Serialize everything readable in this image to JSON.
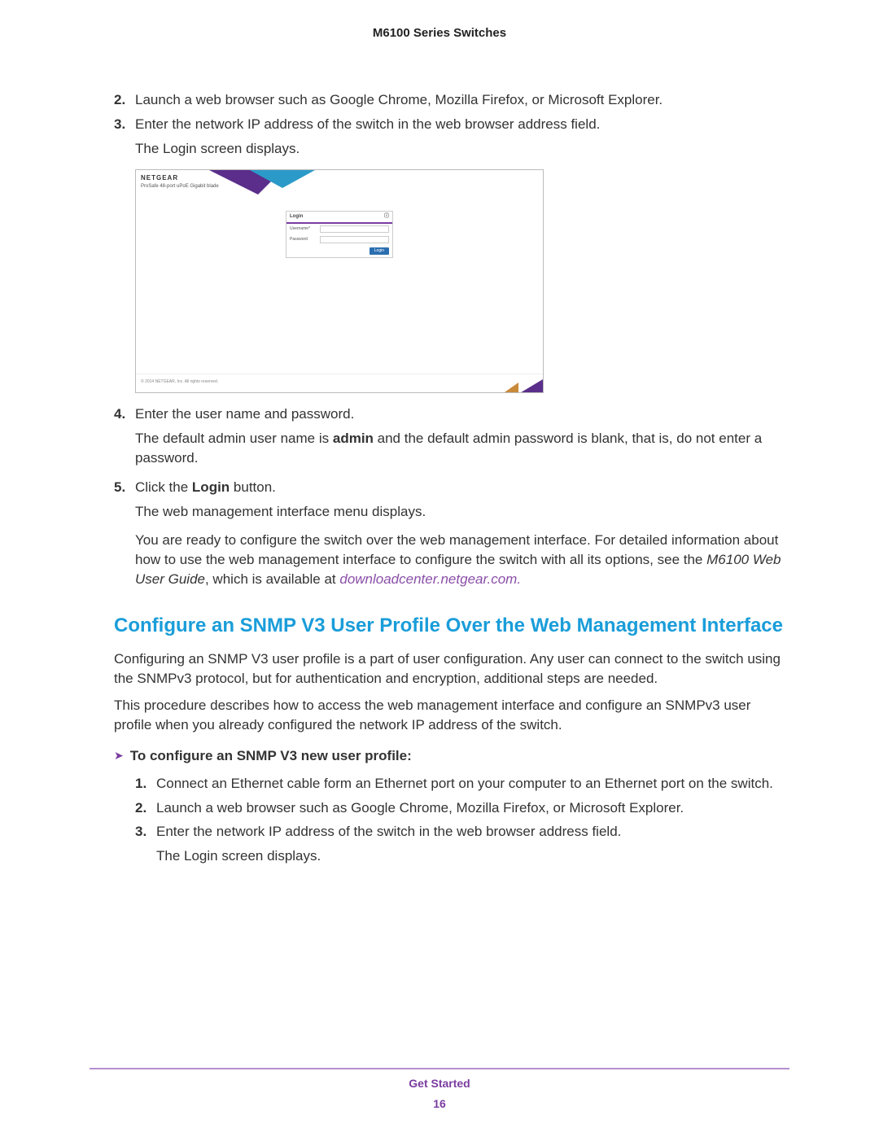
{
  "header": {
    "title": "M6100 Series Switches"
  },
  "steps_top": [
    {
      "num": "2.",
      "text": "Launch a web browser such as Google Chrome, Mozilla Firefox, or Microsoft Explorer."
    },
    {
      "num": "3.",
      "text": "Enter the network IP address of the switch in the web browser address field."
    }
  ],
  "login_displays": "The Login screen displays.",
  "login_figure": {
    "brand": "NETGEAR",
    "subtitle": "ProSafe 48-port uPoE Gigabit blade",
    "card_title": "Login",
    "username_label": "Username*",
    "password_label": "Password",
    "login_button": "Login",
    "copyright": "© 2014 NETGEAR, Inc. All rights reserved."
  },
  "step4": {
    "num": "4.",
    "text": "Enter the user name and password.",
    "detail_pre": "The default admin user name is ",
    "detail_bold": "admin",
    "detail_post": " and the default admin password is blank, that is, do not enter a password."
  },
  "step5": {
    "num": "5.",
    "pre": "Click the ",
    "bold": "Login",
    "post": " button.",
    "result": "The web management interface menu displays.",
    "ready_pre": "You are ready to configure the switch over the web management interface. For detailed information about how to use the web management interface to configure the switch with all its options, see the ",
    "ready_italic": "M6100 Web User Guide",
    "ready_mid": ", which is available at ",
    "ready_link": "downloadcenter.netgear.com",
    "ready_end": "."
  },
  "section_heading": "Configure an SNMP V3 User Profile Over the Web Management Interface",
  "section_p1": "Configuring an SNMP V3 user profile is a part of user configuration. Any user can connect to the switch using the SNMPv3 protocol, but for authentication and encryption, additional steps are needed.",
  "section_p2": "This procedure describes how to access the web management interface and configure an SNMPv3 user profile when you already configured the network IP address of the switch.",
  "task": {
    "chevron": "➤",
    "title": "To configure an SNMP V3 new user profile:"
  },
  "steps_bottom": [
    {
      "num": "1.",
      "text": "Connect an Ethernet cable form an Ethernet port on your computer to an Ethernet port on the switch."
    },
    {
      "num": "2.",
      "text": "Launch a web browser such as Google Chrome, Mozilla Firefox, or Microsoft Explorer."
    },
    {
      "num": "3.",
      "text": "Enter the network IP address of the switch in the web browser address field."
    }
  ],
  "login_displays_2": "The Login screen displays.",
  "footer": {
    "section": "Get Started",
    "page": "16"
  }
}
